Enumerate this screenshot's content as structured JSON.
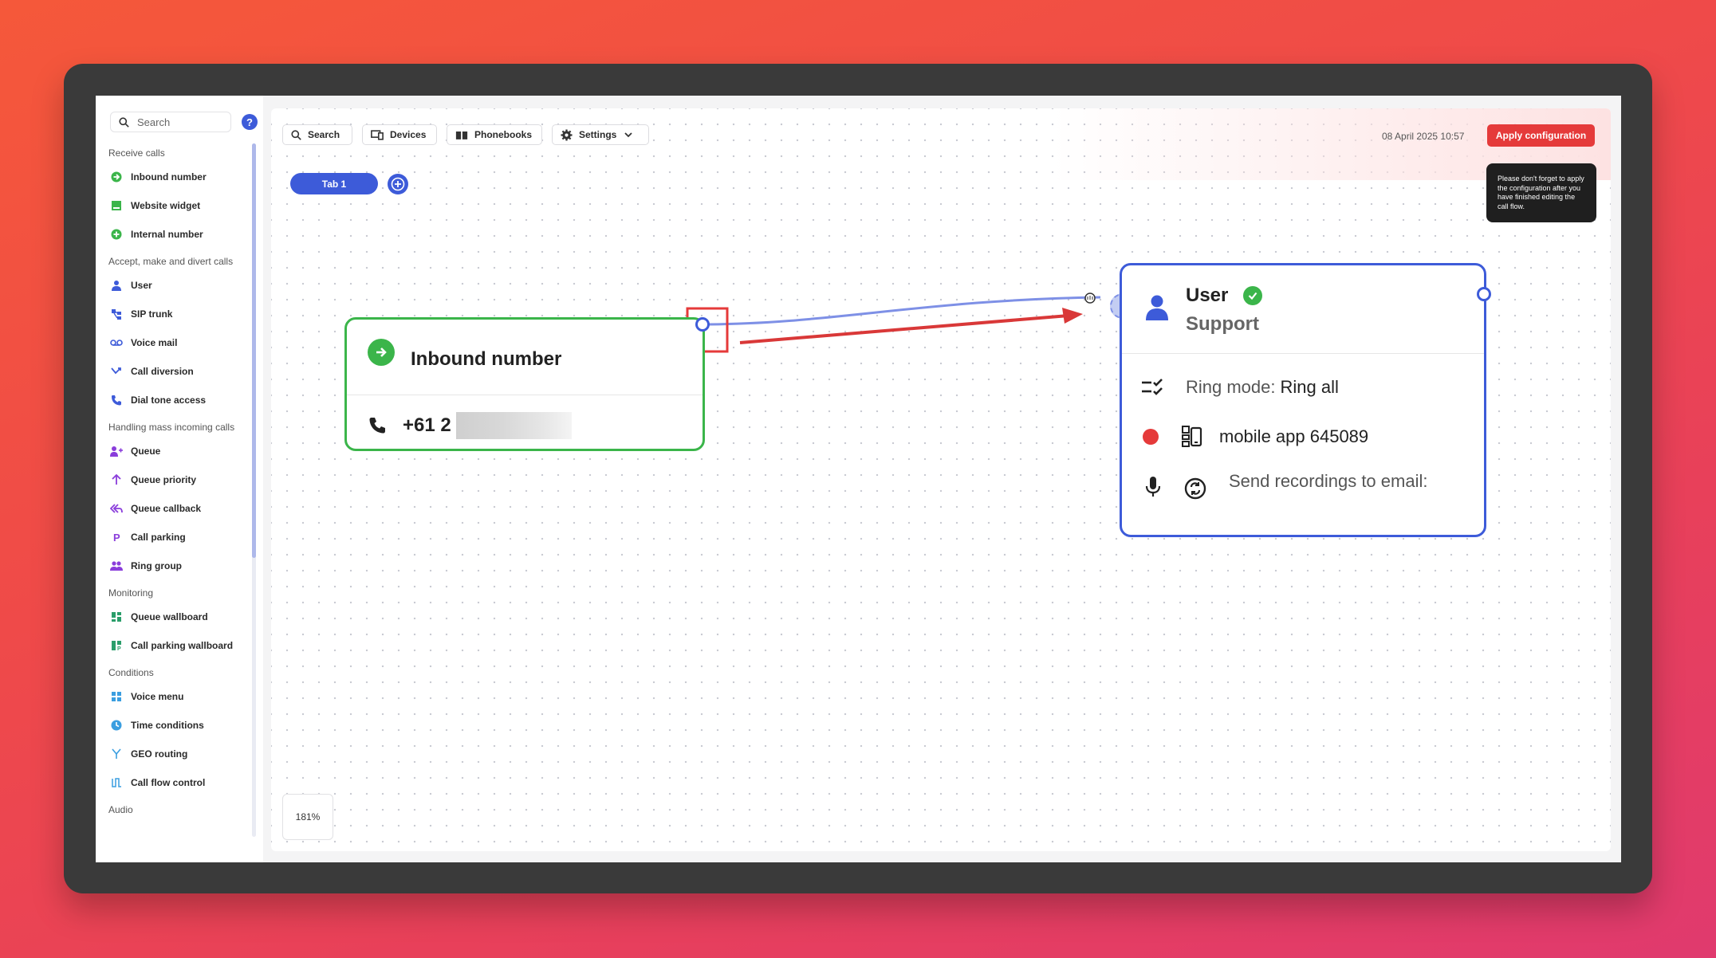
{
  "sidebar": {
    "search_placeholder": "Search",
    "help_label": "?",
    "sections": [
      {
        "title": "Receive calls",
        "items": [
          {
            "label": "Inbound number",
            "icon": "arrow-circle-icon",
            "color": "#3bb54a"
          },
          {
            "label": "Website widget",
            "icon": "widget-icon",
            "color": "#3bb54a"
          },
          {
            "label": "Internal number",
            "icon": "internal-icon",
            "color": "#3bb54a"
          }
        ]
      },
      {
        "title": "Accept, make and divert calls",
        "items": [
          {
            "label": "User",
            "icon": "user-icon",
            "color": "#3d5bd9"
          },
          {
            "label": "SIP trunk",
            "icon": "sip-trunk-icon",
            "color": "#3d5bd9"
          },
          {
            "label": "Voice mail",
            "icon": "voicemail-icon",
            "color": "#3d5bd9"
          },
          {
            "label": "Call diversion",
            "icon": "call-diversion-icon",
            "color": "#3d5bd9"
          },
          {
            "label": "Dial tone access",
            "icon": "dial-tone-icon",
            "color": "#3d5bd9"
          }
        ]
      },
      {
        "title": "Handling mass incoming calls",
        "items": [
          {
            "label": "Queue",
            "icon": "queue-icon",
            "color": "#8a3ddb"
          },
          {
            "label": "Queue priority",
            "icon": "queue-priority-icon",
            "color": "#8a3ddb"
          },
          {
            "label": "Queue callback",
            "icon": "queue-callback-icon",
            "color": "#8a3ddb"
          },
          {
            "label": "Call parking",
            "icon": "call-parking-icon",
            "color": "#8a3ddb"
          },
          {
            "label": "Ring group",
            "icon": "ring-group-icon",
            "color": "#8a3ddb"
          }
        ]
      },
      {
        "title": "Monitoring",
        "items": [
          {
            "label": "Queue wallboard",
            "icon": "queue-wallboard-icon",
            "color": "#2a9e6a"
          },
          {
            "label": "Call parking wallboard",
            "icon": "call-parking-wallboard-icon",
            "color": "#2a9e6a"
          }
        ]
      },
      {
        "title": "Conditions",
        "items": [
          {
            "label": "Voice menu",
            "icon": "voice-menu-icon",
            "color": "#3a9ee0"
          },
          {
            "label": "Time conditions",
            "icon": "clock-icon",
            "color": "#3a9ee0"
          },
          {
            "label": "GEO routing",
            "icon": "geo-routing-icon",
            "color": "#3a9ee0"
          },
          {
            "label": "Call flow control",
            "icon": "call-flow-control-icon",
            "color": "#3a9ee0"
          }
        ]
      },
      {
        "title": "Audio",
        "items": []
      }
    ]
  },
  "toolbar": {
    "search_label": "Search",
    "devices_label": "Devices",
    "phonebooks_label": "Phonebooks",
    "settings_label": "Settings",
    "datetime": "08 April 2025 10:57",
    "apply_label": "Apply configuration",
    "tooltip": "Please don't forget to apply the configuration after you have finished editing the call flow."
  },
  "tabs": [
    {
      "label": "Tab 1"
    }
  ],
  "zoom": "181%",
  "inbound_node": {
    "title": "Inbound number",
    "phone_prefix": "+61 2"
  },
  "user_node": {
    "title": "User",
    "subtitle": "Support",
    "ring_mode_label": "Ring mode:",
    "ring_mode_value": "Ring all",
    "device": "mobile app 645089",
    "recordings_label": "Send recordings to email:"
  },
  "colors": {
    "accent": "#3d5bd9",
    "green": "#3bb54a",
    "red": "#e53a3a"
  }
}
